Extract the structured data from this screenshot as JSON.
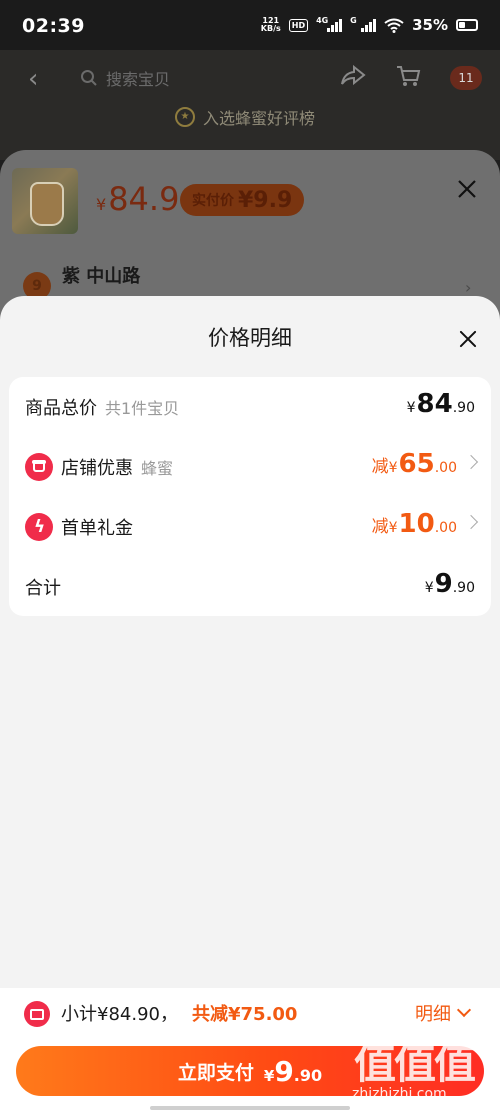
{
  "status_bar": {
    "time": "02:39",
    "net_speed_value": "121",
    "net_speed_unit": "KB/s",
    "hd_label": "HD",
    "network_label_1": "4G",
    "network_label_2": "G",
    "battery_percent": "35%"
  },
  "background_page": {
    "search_placeholder": "搜索宝贝",
    "cart_count": "11",
    "rank_text": "入选蜂蜜好评榜"
  },
  "sku_sheet": {
    "currency": "¥",
    "price": "84.9",
    "real_price_label": "实付价",
    "real_price_value": "¥9.9",
    "address_badge": "9",
    "address": "紫 中山路"
  },
  "price_detail": {
    "title": "价格明细",
    "rows": [
      {
        "label": "商品总价",
        "sub": "共1件宝贝",
        "prefix": "",
        "currency": "¥",
        "int": "84",
        "dec": ".90"
      },
      {
        "label": "店铺优惠",
        "sub": "蜂蜜",
        "prefix": "减",
        "currency": "¥",
        "int": "65",
        "dec": ".00"
      },
      {
        "label": "首单礼金",
        "sub": "",
        "prefix": "减",
        "currency": "¥",
        "int": "10",
        "dec": ".00"
      },
      {
        "label": "合计",
        "sub": "",
        "prefix": "",
        "currency": "¥",
        "int": "9",
        "dec": ".90"
      }
    ]
  },
  "bottom_bar": {
    "subtotal": "小计¥84.90，",
    "total_discount": "共减¥75.00",
    "detail_toggle": "明细",
    "pay_label": "立即支付",
    "pay_currency": "¥",
    "pay_int": "9",
    "pay_dec": ".90"
  },
  "watermark": {
    "chars": "值值值",
    "url": "zhizhizhi.com"
  },
  "colors": {
    "accent_orange": "#f25a12",
    "icon_red": "#f02c4a",
    "pay_gradient_start": "#ff7a1a",
    "pay_gradient_end": "#ff2d24"
  }
}
